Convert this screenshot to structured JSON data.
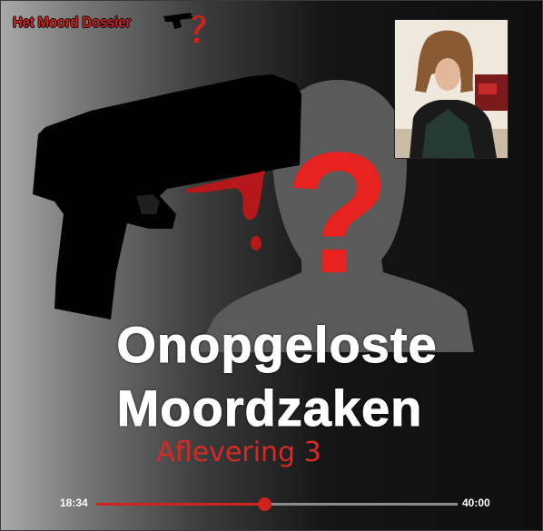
{
  "logo": {
    "text": "Het Moord Dossier"
  },
  "cover": {
    "title_line1": "Onopgeloste",
    "title_line2": "Moordzaken",
    "subtitle": "Aflevering 3",
    "question_mark": "?"
  },
  "player": {
    "current_time": "18:34",
    "duration": "40:00",
    "progress": 0.4642
  },
  "colors": {
    "accent_red": "#d0231f",
    "title_white": "#ffffff",
    "track_gray": "#8c8c8c"
  },
  "icons": [
    "pistol-icon",
    "question-mark-icon",
    "person-silhouette-icon"
  ]
}
